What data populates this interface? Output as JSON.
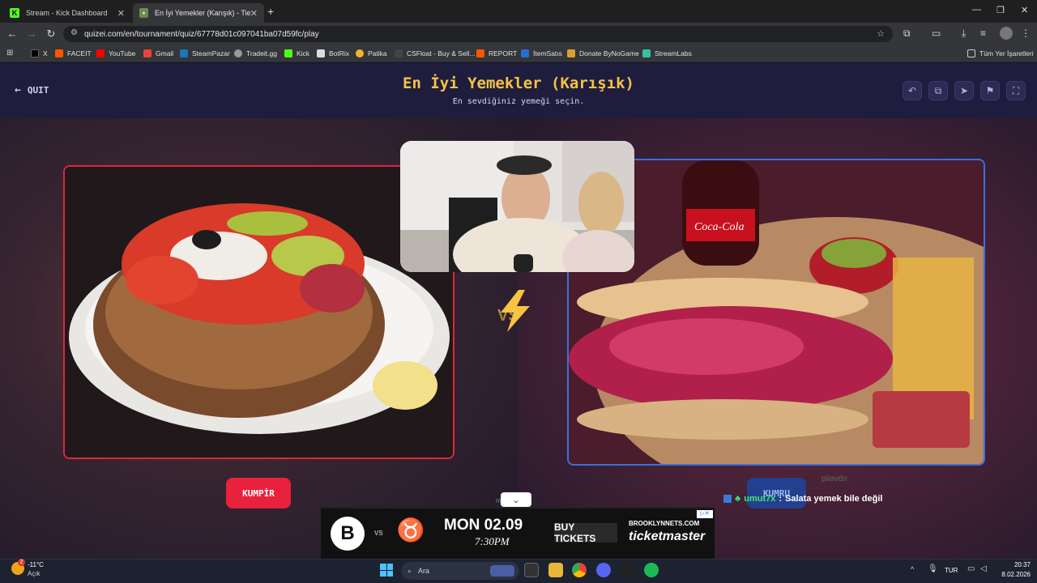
{
  "browser": {
    "tabs": [
      {
        "title": "Stream - Kick Dashboard",
        "active": false
      },
      {
        "title": "En İyi Yemekler (Karışık) - Tier L",
        "active": true
      }
    ],
    "new_tab": "+",
    "url": "quizei.com/en/tournament/quiz/67778d01c097041ba07d59fc/play",
    "bookmarks": [
      "X",
      "FACEIT",
      "YouTube",
      "Gmail",
      "SteamPazar",
      "Tradeit.gg",
      "Kick",
      "BotRix",
      "Patika",
      "CSFloat - Buy & Sell...",
      "REPORT",
      "İtemSatıs",
      "Donate ByNoGame",
      "StreamLabs"
    ],
    "all_bookmarks": "Tüm Yer İşaretleri"
  },
  "quiz": {
    "quit_label": "QUIT",
    "title": "En İyi Yemekler (Karışık)",
    "subtitle": "En sevdiğiniz yemeği seçin.",
    "left_option": "KUMPİR",
    "right_option": "KUMRU",
    "vs_label": "VS",
    "watch_text": "m",
    "watch_text_2": "h"
  },
  "ad": {
    "vs": "VS",
    "date": "MON 02.09",
    "time": "7:30PM",
    "button": "BUY TICKETS",
    "url": "BROOKLYNNETS.COM",
    "brand": "ticketmaster"
  },
  "chat": {
    "faded_text": "pilavdır",
    "username": "umut7x",
    "separator": ":",
    "message": "Salata yemek bile değil"
  },
  "taskbar": {
    "weather_badge": "2",
    "temperature": "-11°C",
    "weather_desc": "Açık",
    "search_placeholder": "Ara",
    "language": "TUR",
    "time": "20:37",
    "date": "8.02.2026"
  },
  "colors": {
    "accent_yellow": "#f6c343",
    "left_red": "#e0263b",
    "right_blue": "#3b6fe0",
    "chat_green": "#3ee87a"
  }
}
